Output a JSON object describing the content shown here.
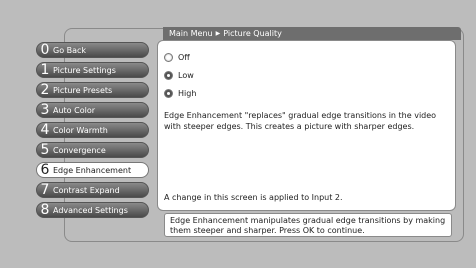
{
  "breadcrumb": {
    "root": "Main Menu",
    "separator": "▶",
    "current": "Picture Quality"
  },
  "menu": [
    {
      "num": "0",
      "label": "Go Back",
      "selected": false
    },
    {
      "num": "1",
      "label": "Picture Settings",
      "selected": false
    },
    {
      "num": "2",
      "label": "Picture Presets",
      "selected": false
    },
    {
      "num": "3",
      "label": "Auto Color",
      "selected": false
    },
    {
      "num": "4",
      "label": "Color Warmth",
      "selected": false
    },
    {
      "num": "5",
      "label": "Convergence",
      "selected": false
    },
    {
      "num": "6",
      "label": "Edge Enhancement",
      "selected": true
    },
    {
      "num": "7",
      "label": "Contrast Expand",
      "selected": false
    },
    {
      "num": "8",
      "label": "Advanced Settings",
      "selected": false
    }
  ],
  "options": [
    {
      "label": "Off",
      "state": "selected"
    },
    {
      "label": "Low",
      "state": "unselected"
    },
    {
      "label": "High",
      "state": "unselected"
    }
  ],
  "description": "Edge Enhancement \"replaces\" gradual edge transitions in the video with steeper edges. This creates a picture with sharper edges.",
  "note": "A change in this screen is applied to Input 2.",
  "help": "Edge Enhancement manipulates gradual edge transitions by making them steeper and sharper. Press OK to continue."
}
